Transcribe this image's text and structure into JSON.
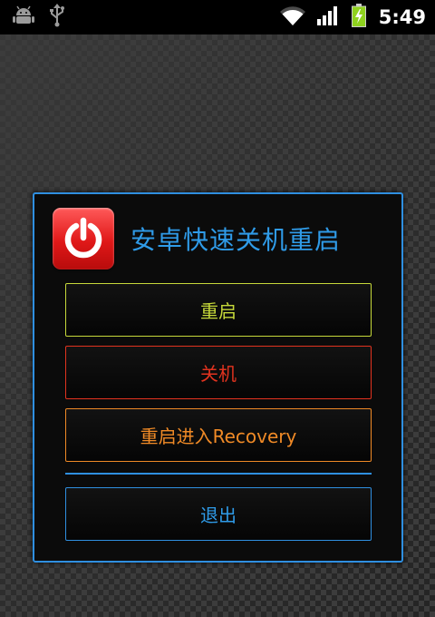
{
  "status_bar": {
    "time": "5:49",
    "icons": [
      "android-debug-icon",
      "usb-icon",
      "wifi-icon",
      "signal-icon",
      "battery-charging-icon"
    ],
    "battery_color": "#8fd21e"
  },
  "dialog": {
    "title": "安卓快速关机重启",
    "icon": "power-icon",
    "accent_color": "#2f8fe0",
    "buttons": {
      "reboot": {
        "label": "重启",
        "color": "#c6d83a"
      },
      "shutdown": {
        "label": "关机",
        "color": "#e2331f"
      },
      "recovery": {
        "label": "重启进入Recovery",
        "color": "#f08a26"
      },
      "exit": {
        "label": "退出",
        "color": "#2f9be8"
      }
    }
  }
}
